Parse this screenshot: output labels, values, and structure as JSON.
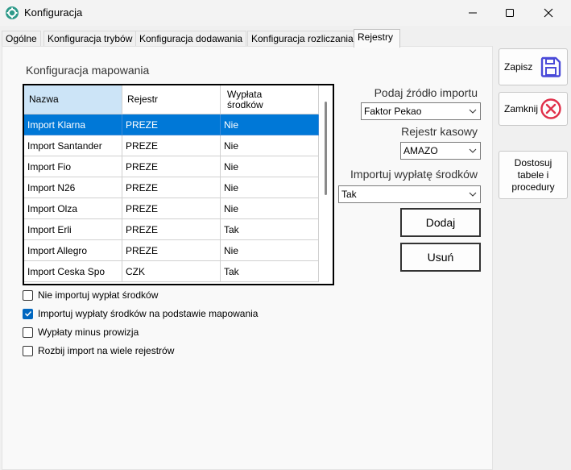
{
  "window": {
    "title": "Konfiguracja",
    "icon": "gear-icon",
    "controls": [
      "minimize-icon",
      "maximize-icon",
      "close-icon"
    ]
  },
  "tabs": [
    {
      "label": "Ogólne",
      "active": false
    },
    {
      "label": "Konfiguracja trybów",
      "active": false
    },
    {
      "label": "Konfiguracja dodawania",
      "active": false
    },
    {
      "label": "Konfiguracja rozliczania",
      "active": false
    },
    {
      "label": "Rejestry",
      "active": true
    }
  ],
  "mapping": {
    "group_label": "Konfiguracja mapowania",
    "columns": [
      "Nazwa",
      "Rejestr",
      "Wypłata\nśrodków"
    ],
    "rows": [
      {
        "nazwa": "Import Klarna",
        "rejestr": "PREZE",
        "wyplata": "Nie",
        "selected": true
      },
      {
        "nazwa": "Import Santander",
        "rejestr": "PREZE",
        "wyplata": "Nie",
        "selected": false
      },
      {
        "nazwa": "Import Fio",
        "rejestr": "PREZE",
        "wyplata": "Nie",
        "selected": false
      },
      {
        "nazwa": "Import N26",
        "rejestr": "PREZE",
        "wyplata": "Nie",
        "selected": false
      },
      {
        "nazwa": "Import Olza",
        "rejestr": "PREZE",
        "wyplata": "Nie",
        "selected": false
      },
      {
        "nazwa": "Import Erli",
        "rejestr": "PREZE",
        "wyplata": "Tak",
        "selected": false
      },
      {
        "nazwa": "Import Allegro",
        "rejestr": "PREZE",
        "wyplata": "Nie",
        "selected": false
      },
      {
        "nazwa": "Import Ceska Spo",
        "rejestr": "CZK",
        "wyplata": "Tak",
        "selected": false
      }
    ]
  },
  "options": [
    {
      "label": "Nie importuj wypłat środków",
      "checked": false
    },
    {
      "label": "Importuj wypłaty środków na podstawie mapowania",
      "checked": true
    },
    {
      "label": "Wypłaty minus prowizja",
      "checked": false
    },
    {
      "label": "Rozbij import na wiele rejestrów",
      "checked": false
    }
  ],
  "form": {
    "source_label": "Podaj źródło importu",
    "source_value": "Faktor Pekao",
    "register_label": "Rejestr kasowy",
    "register_value": "AMAZO",
    "payout_label": "Importuj wypłatę środków",
    "payout_value": "Tak",
    "add_label": "Dodaj",
    "remove_label": "Usuń"
  },
  "side": {
    "save_label": "Zapisz",
    "close_label": "Zamknij",
    "customize_label": "Dostosuj\ntabele i\nprocedury"
  },
  "colors": {
    "selection": "#0078d7",
    "header_selected": "#cce4f7",
    "save_icon": "#4a4ad8",
    "close_icon": "#e0304a",
    "checkbox_on": "#0067c0"
  }
}
